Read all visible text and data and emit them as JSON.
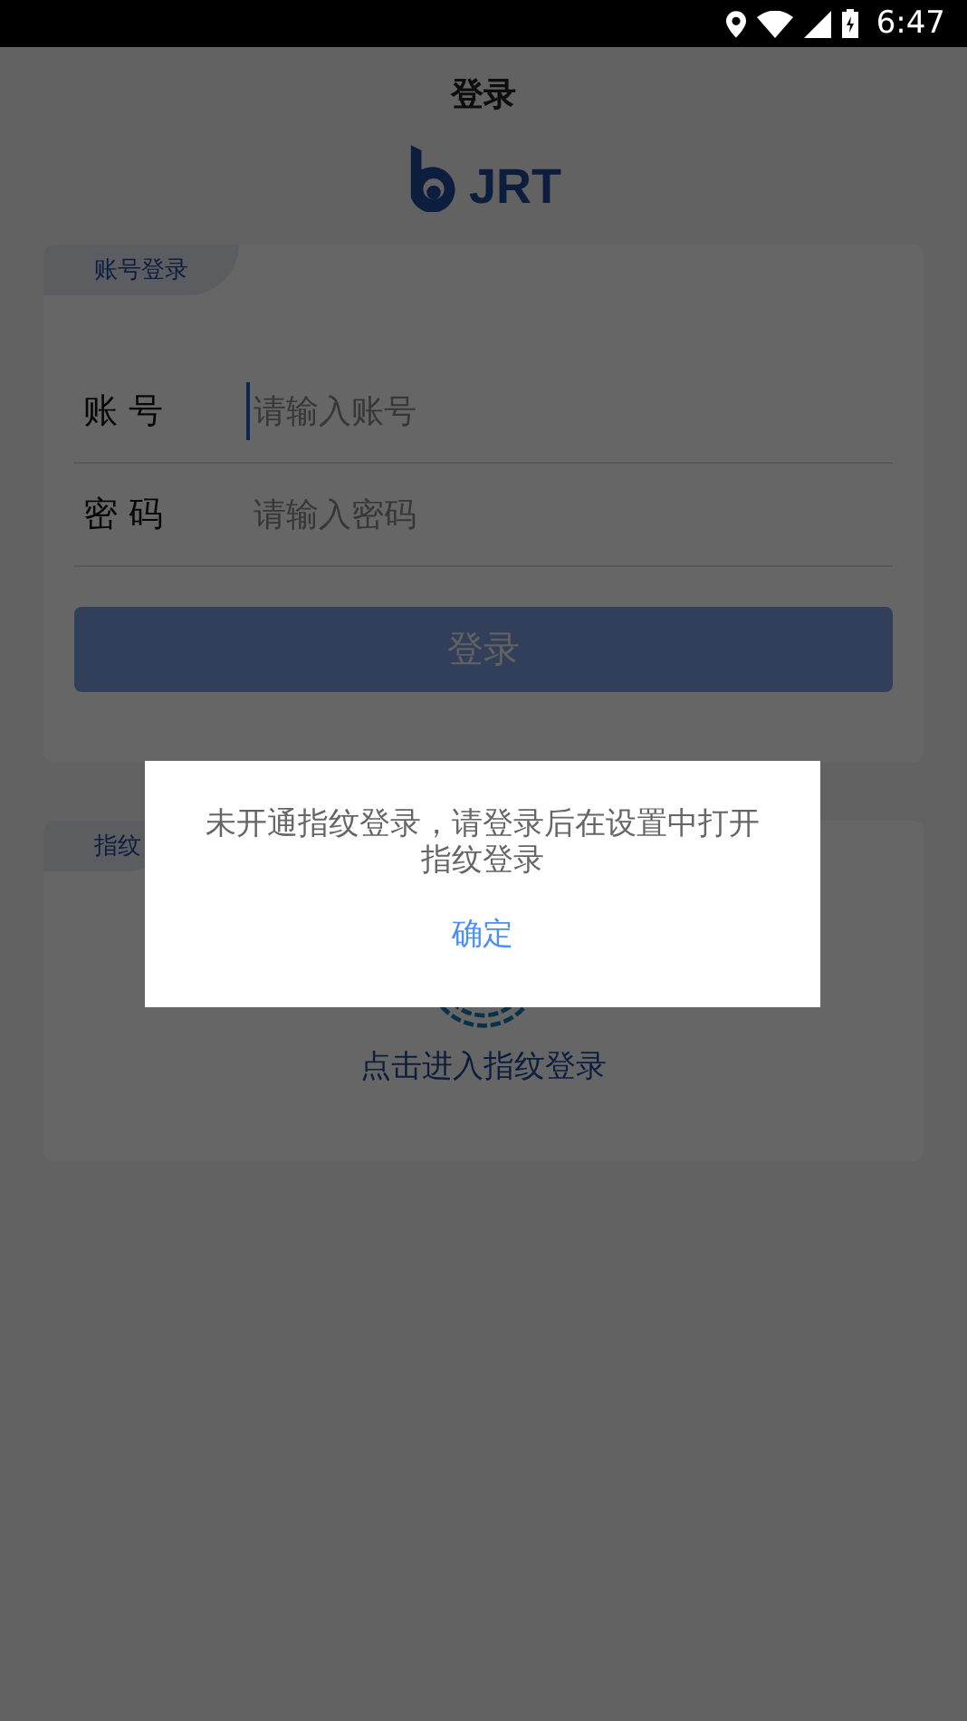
{
  "status_bar": {
    "time": "6:47"
  },
  "header": {
    "title": "登录",
    "logo_text": "JRT"
  },
  "account_card": {
    "tab": "账号登录",
    "fields": [
      {
        "label": "账 号",
        "placeholder": "请输入账号",
        "focused": true
      },
      {
        "label": "密 码",
        "placeholder": "请输入密码",
        "focused": false
      }
    ],
    "submit": "登录"
  },
  "fingerprint_card": {
    "tab": "指纹",
    "action": "点击进入指纹登录"
  },
  "dialog": {
    "message": "未开通指纹登录，请登录后在设置中打开指纹登录",
    "button": "确定"
  }
}
